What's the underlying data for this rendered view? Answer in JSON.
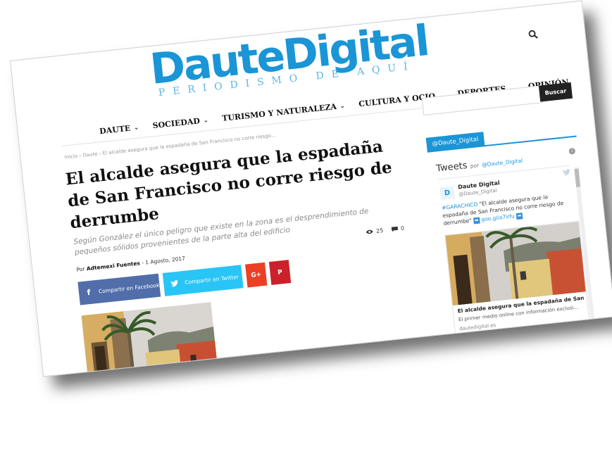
{
  "site": {
    "logo_main": "DauteDigital",
    "logo_tagline": "PERIODISMO DE AQUÍ",
    "brand_color": "#1a95d6",
    "search_icon": "search-icon"
  },
  "nav": {
    "items": [
      {
        "label": "DAUTE",
        "has_dropdown": true
      },
      {
        "label": "SOCIEDAD",
        "has_dropdown": true
      },
      {
        "label": "TURISMO Y NATURALEZA",
        "has_dropdown": true
      },
      {
        "label": "CULTURA Y OCIO",
        "has_dropdown": true
      },
      {
        "label": "DEPORTES",
        "has_dropdown": true
      },
      {
        "label": "OPINIÓN",
        "has_dropdown": false
      }
    ]
  },
  "search": {
    "placeholder": "",
    "button_label": "Buscar"
  },
  "breadcrumb": {
    "items": [
      "Inicio",
      "Daute",
      "El alcalde asegura que la espadaña de San Francisco no corre riesgo..."
    ],
    "separator": "›"
  },
  "article": {
    "title": "El alcalde asegura que la espadaña de San Francisco no corre riesgo de derrumbe",
    "subtitle": "Según González el único peligro que existe en la zona es el desprendimiento de pequeños sólidos provenientes de la parte alta del edificio",
    "views": "25",
    "comments": "0",
    "byline_prefix": "Por",
    "author": "Adtemexi Fuentes",
    "date": "1 Agosto, 2017"
  },
  "share": {
    "facebook_label": "Compartir en Facebook",
    "twitter_label": "Compartir en Twitter",
    "googleplus_glyph": "G+",
    "pinterest_glyph": "P",
    "facebook_color": "#516eab",
    "twitter_color": "#29c5f6",
    "googleplus_color": "#eb4026",
    "pinterest_color": "#ca212a"
  },
  "sidebar": {
    "tab_label": "@Daute_Digital",
    "twitter": {
      "heading": "Tweets",
      "by_text": "por",
      "handle": "@Daute_Digital",
      "tweet": {
        "author": "Daute Digital",
        "username": "@Daute_Digital",
        "hashtag": "#GARACHICO",
        "text": "\"El alcalde asegura que la espadaña de San Francisco no corre riesgo de derrumbe\"",
        "link": "goo.gl/a7irfu",
        "card_title": "El alcalde asegura que la espadaña de San ...",
        "card_desc": "El primer medio online con información exclusi...",
        "card_domain": "dautedigital.es"
      }
    }
  }
}
